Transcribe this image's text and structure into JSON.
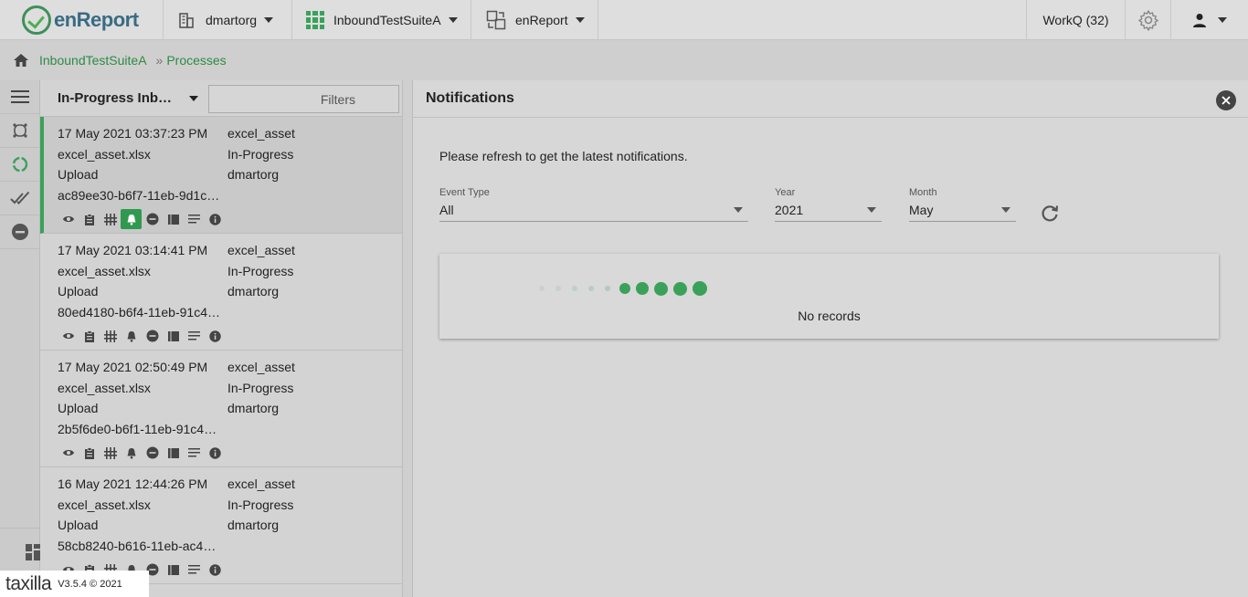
{
  "app": {
    "logo_text": "enReport"
  },
  "topbar": {
    "org": "dmartorg",
    "suite": "InboundTestSuiteA",
    "app_name": "enReport",
    "workq": "WorkQ (32)"
  },
  "breadcrumb": {
    "items": [
      "InboundTestSuiteA",
      "Processes"
    ],
    "separator": "»"
  },
  "list": {
    "title": "In-Progress Inbound Processes",
    "filters_label": "Filters",
    "processes": [
      {
        "date": "17 May 2021 03:37:23 PM",
        "asset": "excel_asset",
        "file": "excel_asset.xlsx",
        "status": "In-Progress",
        "type": "Upload",
        "org": "dmartorg",
        "id": "ac89ee30-b6f7-11eb-9d1c-1..."
      },
      {
        "date": "17 May 2021 03:14:41 PM",
        "asset": "excel_asset",
        "file": "excel_asset.xlsx",
        "status": "In-Progress",
        "type": "Upload",
        "org": "dmartorg",
        "id": "80ed4180-b6f4-11eb-91c4-..."
      },
      {
        "date": "17 May 2021 02:50:49 PM",
        "asset": "excel_asset",
        "file": "excel_asset.xlsx",
        "status": "In-Progress",
        "type": "Upload",
        "org": "dmartorg",
        "id": "2b5f6de0-b6f1-11eb-91c4-7..."
      },
      {
        "date": "16 May 2021 12:44:26 PM",
        "asset": "excel_asset",
        "file": "excel_asset.xlsx",
        "status": "In-Progress",
        "type": "Upload",
        "org": "dmartorg",
        "id": "58cb8240-b616-11eb-ac46-..."
      }
    ]
  },
  "notifications": {
    "title": "Notifications",
    "refresh_message": "Please refresh to get the latest notifications.",
    "event_type": {
      "label": "Event Type",
      "value": "All"
    },
    "year": {
      "label": "Year",
      "value": "2021"
    },
    "month": {
      "label": "Month",
      "value": "May"
    },
    "empty_text": "No records"
  },
  "footer": {
    "brand": "taxilla",
    "version": "V3.5.4 © 2021"
  },
  "colors": {
    "accent": "#3aa15a",
    "link": "#2e8a47"
  }
}
